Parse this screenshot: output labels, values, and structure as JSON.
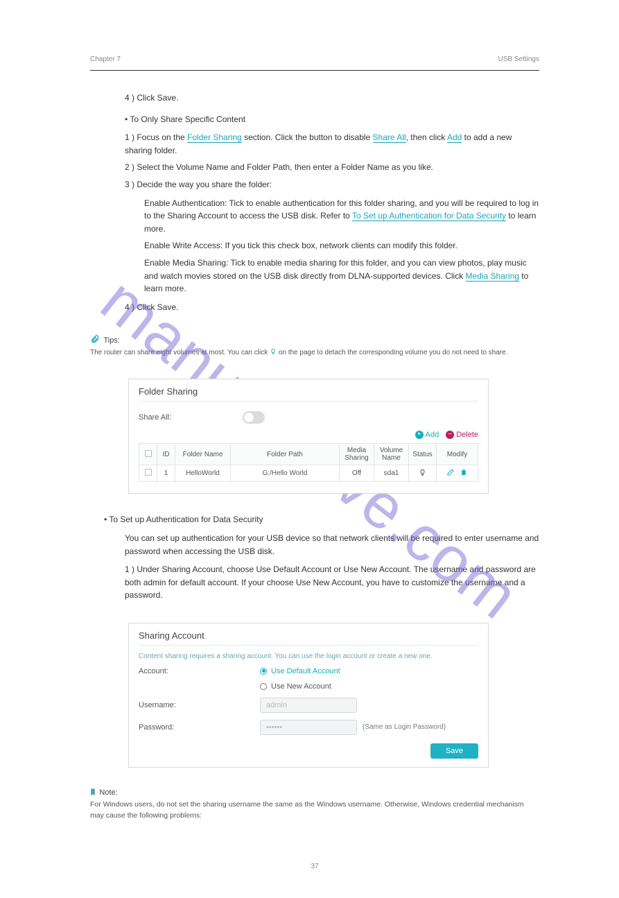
{
  "header": {
    "chapter": "Chapter 7",
    "title": "USB Settings"
  },
  "watermark": "manualshive.com",
  "intro": {
    "t1": "4 )   Click ",
    "t1b": "Save",
    "t1c": ".",
    "line2_a": "•  To Only Share Specific Content",
    "step1a": "1 )   Focus on the ",
    "step1b": "Folder Sharing",
    "step1c": " section. Click the button to disable ",
    "step1d": "Share All",
    "step1e": ", then click ",
    "step1f": "Add",
    "step1g": " to add a new sharing folder.",
    "step2a": "2 )   Select the ",
    "step2b": "Volume Name",
    "step2c": " and ",
    "step2d": "Folder Path",
    "step2e": ",  then  enter  a ",
    "step2f": "Folder Name",
    "step2g": " as you like.",
    "step3a": "3 )   Decide the way you share the folder:"
  },
  "subitems": {
    "a1": "Enable Authentication",
    "a2": ":  Tick  to  enable  authentication  for  this  folder ",
    "a3": "sharing,  and  you  will  be  required  to  log  in  to  the  Sharing  Account  to ",
    "a4": "access the USB disk. Refer to ",
    "a5": "To Set up Authentication for Data Security",
    "a6": " to learn more.",
    "b1": "Enable Write Access",
    "b2": ": If you tick this check box, network clients can modify this folder.",
    "c1": "Enable Media Sharing",
    "c2": ": Tick to enable media sharing for this folder, and you can view photos, play music and watch movies stored on the USB disk directly from DLNA-supported devices. Click ",
    "c3": "Media Sharing",
    "c4": " to learn more.",
    "step4": "4 )   Click ",
    "step4b": "Save",
    "step4c": "."
  },
  "tips": {
    "title": "Tips:",
    "text_a": "The router can share eight volumes at most. You can click ",
    "text_b": " on the page to detach the corresponding volume you do not need to share."
  },
  "folder_panel": {
    "title": "Folder Sharing",
    "share_all": "Share All:",
    "add": "Add",
    "delete": "Delete",
    "cols": [
      "",
      "ID",
      "Folder Name",
      "Folder Path",
      "Media Sharing",
      "Volume Name",
      "Status",
      "Modify"
    ],
    "row": {
      "id": "1",
      "name": "HelloWorld",
      "path": "G:/Hello World",
      "media": "Off",
      "vol": "sda1"
    }
  },
  "after_panel": {
    "heading": "•  To Set up Authentication for Data Security",
    "p1": "You  can  set  up  authentication  for  your  USB  device  so  that  network  clients  will be required to enter username and password when accessing the USB disk.",
    "li1_a": "1 )   Under ",
    "li1_b": "Sharing Account",
    "li1_c": ",  choose ",
    "li1_d": "Use Default Account",
    "li1_e": "  or ",
    "li1_f": "Use New Account",
    "li1_g": ". The username and password are both ",
    "li1_h": "admin",
    "li1_i": " for default account. If your choose ",
    "li1_j": "Use New Account",
    "li1_k": ", you have to customize the username and a password."
  },
  "account_panel": {
    "title": "Sharing Account",
    "hint": "Content sharing requires a sharing account. You can use the login account or create a new one.",
    "account_label": "Account:",
    "opt1": "Use Default Account",
    "opt2": "Use New Account",
    "username_label": "Username:",
    "username_value": "admin",
    "password_label": "Password:",
    "password_value": "••••••",
    "same_note": "(Same as Login Password)",
    "save": "Save"
  },
  "note": {
    "title": "Note:",
    "text": "For Windows users, do not set the sharing username the same as the Windows username. Otherwise, Windows credential mechanism may cause the following problems:"
  },
  "page_number": "37"
}
